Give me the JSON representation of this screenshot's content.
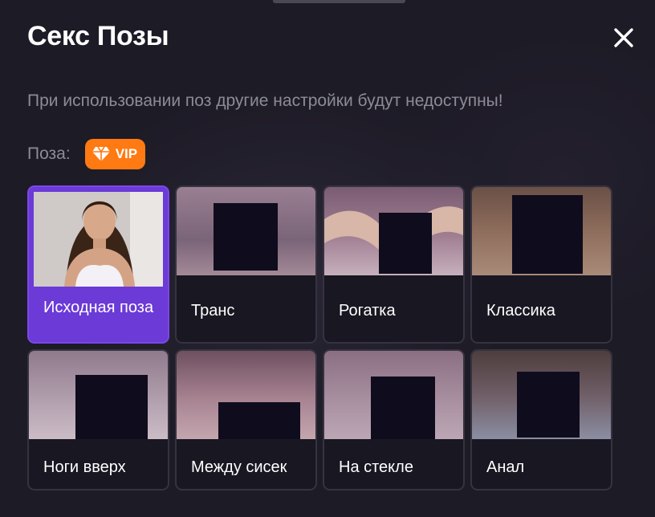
{
  "header": {
    "title": "Секс Позы",
    "close_icon": "close-icon"
  },
  "notice": "При использовании поз другие настройки будут недоступны!",
  "pose": {
    "label": "Поза:",
    "vip_badge": {
      "icon": "diamond-icon",
      "label": "VIP"
    }
  },
  "colors": {
    "background": "#1d1b26",
    "accent_selected": "#6b3ad7",
    "vip_orange": "#ff7a12",
    "censor_box": "#0f0c1d",
    "muted_text": "#8d8b95"
  },
  "poses": [
    {
      "label": "Исходная поза",
      "selected": true
    },
    {
      "label": "Транс",
      "selected": false
    },
    {
      "label": "Рогатка",
      "selected": false
    },
    {
      "label": "Классика",
      "selected": false
    },
    {
      "label": "Ноги вверх",
      "selected": false
    },
    {
      "label": "Между сисек",
      "selected": false
    },
    {
      "label": "На стекле",
      "selected": false
    },
    {
      "label": "Анал",
      "selected": false
    }
  ]
}
